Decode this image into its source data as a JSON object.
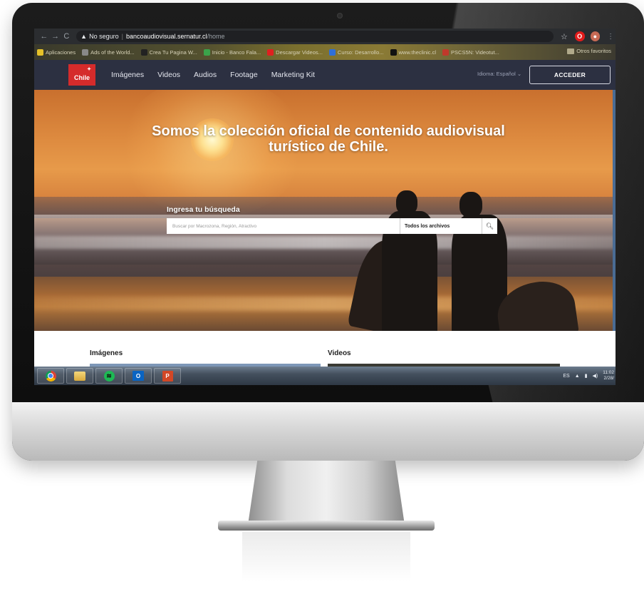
{
  "browser": {
    "nav_back": "←",
    "nav_forward": "→",
    "nav_reload": "C",
    "security_icon": "warning-triangle-icon",
    "security_label": "No seguro",
    "url_host": "bancoaudiovisual.sernatur.cl",
    "url_path": "/home",
    "bookmarks": [
      {
        "label": "Aplicaciones",
        "icon": "apps-grid-icon",
        "color": "#e6c229"
      },
      {
        "label": "Ads of the World...",
        "icon": "globe-icon",
        "color": "#888888"
      },
      {
        "label": "Crea Tu Pagina W...",
        "icon": "wix-icon",
        "color": "#222222"
      },
      {
        "label": "Inicio - Banco Fala...",
        "icon": "bank-icon",
        "color": "#3ba34a"
      },
      {
        "label": "Descargar Videos...",
        "icon": "youtube-icon",
        "color": "#e02020"
      },
      {
        "label": "Curso: Desarrollo...",
        "icon": "course-icon",
        "color": "#2f6fd8"
      },
      {
        "label": "www.theclinic.cl",
        "icon": "clinic-icon",
        "color": "#111111"
      },
      {
        "label": "PSCS5N: Videotut...",
        "icon": "video-tutorial-icon",
        "color": "#c0392b"
      }
    ],
    "other_bookmarks": "Otros favoritos"
  },
  "site": {
    "logo_text": "Chile",
    "nav": [
      "Imágenes",
      "Videos",
      "Audios",
      "Footage",
      "Marketing Kit"
    ],
    "language": "Idioma: Español",
    "login_button": "ACCEDER",
    "hero_title_line1": "Somos la colección oficial de contenido audiovisual",
    "hero_title_line2": "turístico de Chile.",
    "search_label": "Ingresa tu búsqueda",
    "search_placeholder": "Buscar por Macrozona, Región, Atractivo",
    "search_filter": "Todos los archivos",
    "sections": [
      "Imágenes",
      "Videos"
    ]
  },
  "taskbar": {
    "apps": [
      "chrome-icon",
      "file-explorer-icon",
      "spotify-icon",
      "outlook-icon",
      "powerpoint-icon"
    ],
    "language": "ES",
    "time": "11:02",
    "date": "2/28/"
  }
}
